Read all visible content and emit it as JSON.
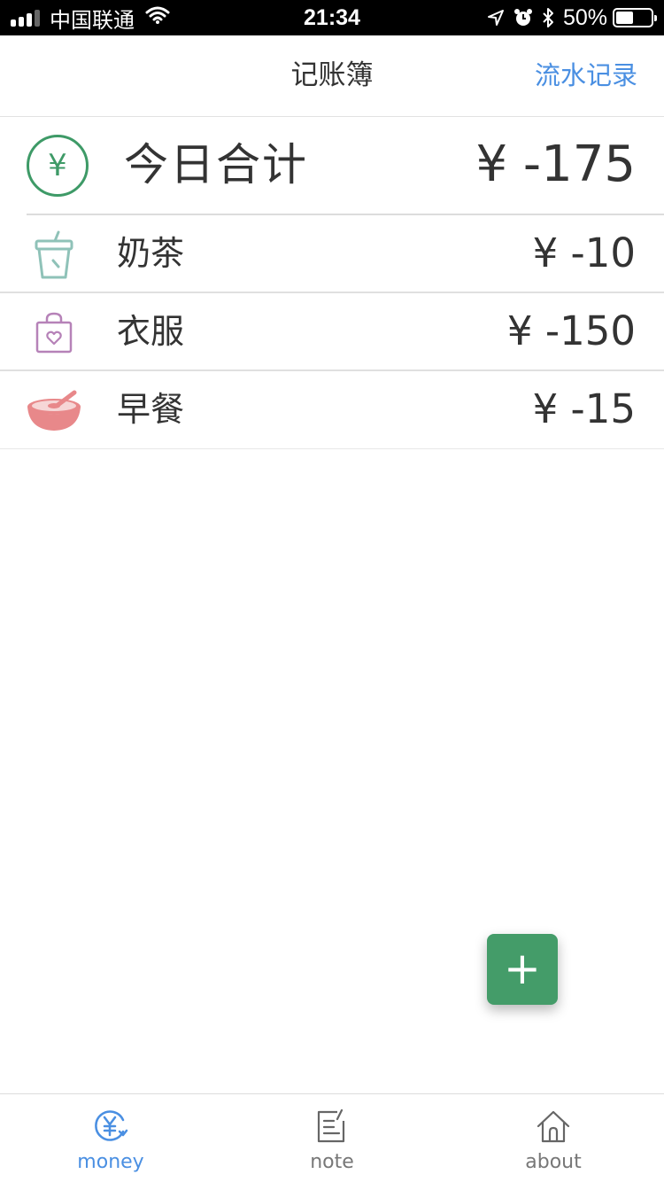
{
  "status_bar": {
    "carrier": "中国联通",
    "time": "21:34",
    "battery": "50%",
    "battery_level": 0.5,
    "icons": [
      "signal-icon",
      "wifi-icon",
      "location-icon",
      "alarm-icon",
      "bluetooth-icon",
      "battery-icon"
    ]
  },
  "nav": {
    "title": "记账簿",
    "action_label": "流水记录"
  },
  "summary": {
    "icon": "yen-circle-icon",
    "icon_glyph": "¥",
    "label": "今日合计",
    "amount": "¥ -175"
  },
  "entries": [
    {
      "icon": "milk-tea-cup-icon",
      "label": "奶茶",
      "amount": "¥ -10"
    },
    {
      "icon": "shopping-bag-icon",
      "label": "衣服",
      "amount": "¥ -150"
    },
    {
      "icon": "breakfast-bowl-icon",
      "label": "早餐",
      "amount": "¥ -15"
    }
  ],
  "fab": {
    "label": "+"
  },
  "tabs": [
    {
      "label": "money",
      "icon": "money-icon",
      "active": true
    },
    {
      "label": "note",
      "icon": "note-icon",
      "active": false
    },
    {
      "label": "about",
      "icon": "home-icon",
      "active": false
    }
  ],
  "colors": {
    "accent_blue": "#4a8fe2",
    "accent_green": "#449c69",
    "cup": "#8fc2b8",
    "bag": "#b682b8",
    "bowl": "#e8888a"
  }
}
